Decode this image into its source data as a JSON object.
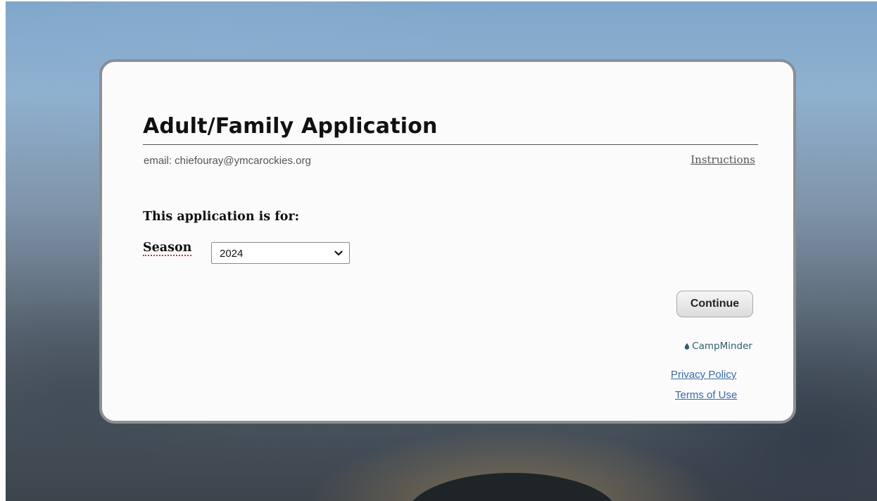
{
  "form": {
    "title": "Adult/Family Application",
    "email_line": "email: chiefouray@ymcarockies.org",
    "instructions_link": "Instructions",
    "for_heading": "This application is for:",
    "season_label": "Season",
    "season_selected": "2024",
    "continue_label": "Continue"
  },
  "footer": {
    "brand": "CampMinder",
    "privacy_link": "Privacy Policy",
    "terms_link": "Terms of Use"
  },
  "colors": {
    "link": "#3a6aa8",
    "brand": "#2f5f6e",
    "card_border": "#8a8f95",
    "validation_underline": "#c0392b"
  },
  "icons": {
    "select_chevron": "chevron-down-icon",
    "brand_logo": "campminder-drop-icon"
  }
}
